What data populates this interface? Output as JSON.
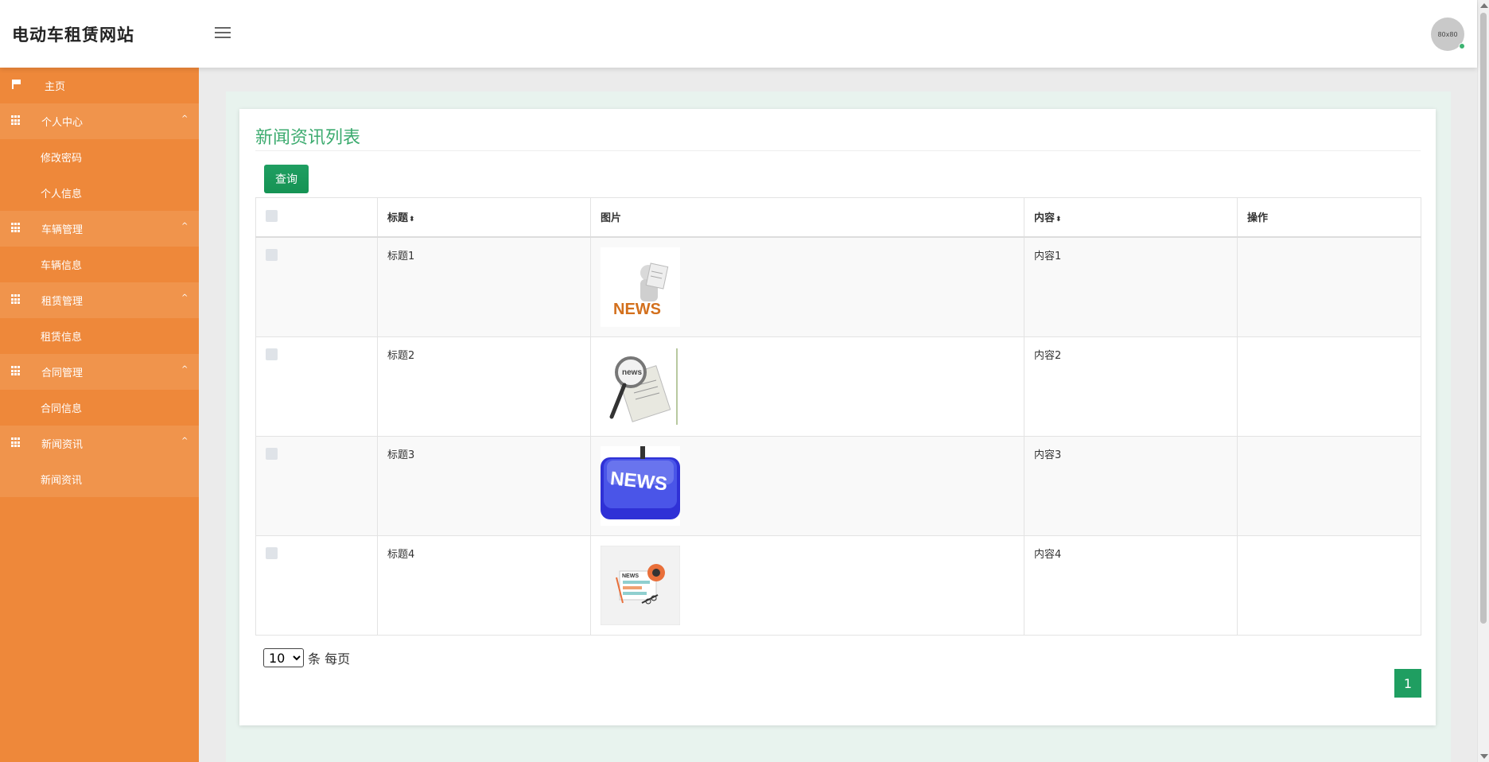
{
  "header": {
    "brand": "电动车租赁网站",
    "avatar_text": "80x80"
  },
  "sidebar": {
    "items": [
      {
        "label": "主页",
        "type": "top",
        "icon": "flag-icon"
      },
      {
        "label": "个人中心",
        "type": "parent",
        "icon": "grid-icon",
        "caret": "^"
      },
      {
        "label": "修改密码",
        "type": "sub"
      },
      {
        "label": "个人信息",
        "type": "sub"
      },
      {
        "label": "车辆管理",
        "type": "parent",
        "icon": "grid-icon",
        "caret": "^"
      },
      {
        "label": "车辆信息",
        "type": "sub"
      },
      {
        "label": "租赁管理",
        "type": "parent",
        "icon": "grid-icon",
        "caret": "^"
      },
      {
        "label": "租赁信息",
        "type": "sub"
      },
      {
        "label": "合同管理",
        "type": "parent",
        "icon": "grid-icon",
        "caret": "^"
      },
      {
        "label": "合同信息",
        "type": "sub"
      },
      {
        "label": "新闻资讯",
        "type": "parent",
        "icon": "grid-icon",
        "caret": "^"
      },
      {
        "label": "新闻资讯",
        "type": "sub",
        "active": true
      }
    ]
  },
  "main": {
    "title": "新闻资讯列表",
    "query_button": "查询",
    "columns": [
      "标题",
      "图片",
      "内容",
      "操作"
    ],
    "sort_glyph": "⬍",
    "rows": [
      {
        "title": "标题1",
        "image": "news-person-image",
        "content": "内容1"
      },
      {
        "title": "标题2",
        "image": "news-magnifier-image",
        "content": "内容2"
      },
      {
        "title": "标题3",
        "image": "news-key-image",
        "content": "内容3"
      },
      {
        "title": "标题4",
        "image": "news-paper-image",
        "content": "内容4"
      }
    ],
    "page_size": "10",
    "page_size_label": "条 每页",
    "current_page": "1"
  },
  "colors": {
    "sidebar": "#ee883a",
    "sidebar_parent": "#f0944c",
    "accent": "#1f9e61",
    "title": "#3cab6f"
  }
}
